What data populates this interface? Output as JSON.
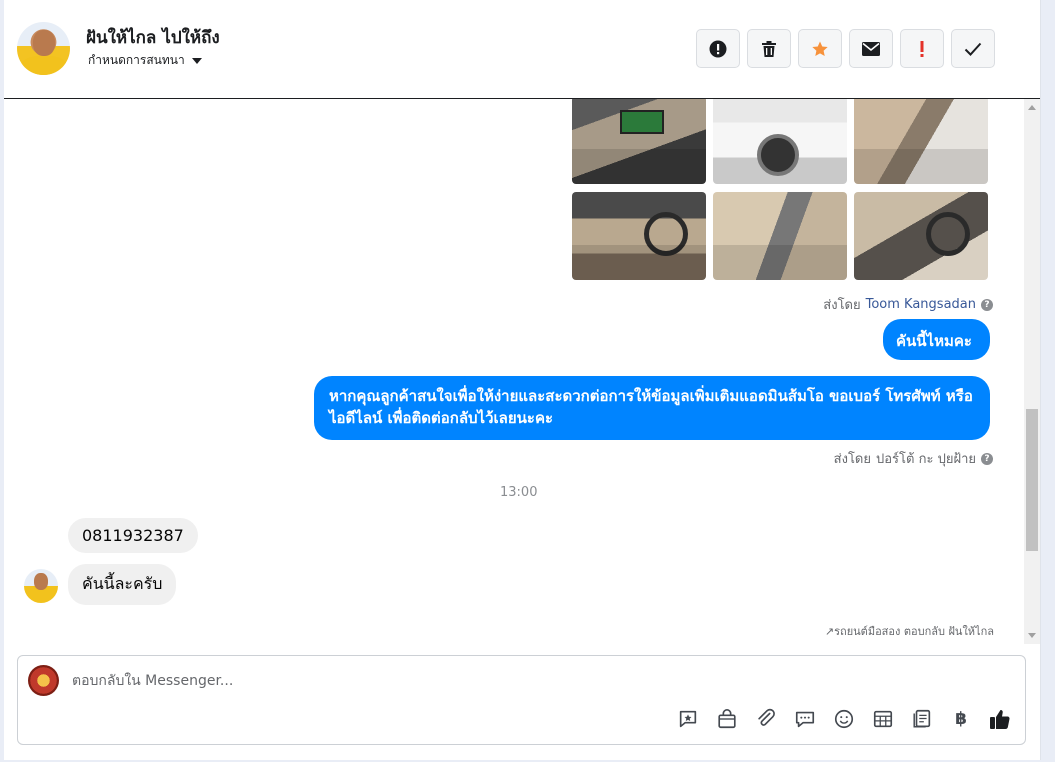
{
  "header": {
    "contact_name": "ฝันให้ไกล ไปให้ถึง",
    "assign_label": "กำหนดการสนทนา",
    "actions": [
      {
        "name": "report-spam",
        "icon": "exclamation-circle-icon"
      },
      {
        "name": "delete",
        "icon": "trash-icon"
      },
      {
        "name": "star",
        "icon": "star-icon",
        "color": "#f7923b"
      },
      {
        "name": "mark-unread",
        "icon": "envelope-icon"
      },
      {
        "name": "follow-up",
        "icon": "exclamation-icon",
        "color": "#e4322a"
      },
      {
        "name": "mark-done",
        "icon": "check-icon"
      }
    ]
  },
  "conversation": {
    "sent_by_1": {
      "prefix": "ส่งโดย",
      "name": "Toom Kangsadan"
    },
    "msg_out_1": "คันนี้ไหมคะ",
    "msg_out_2": "หากคุณลูกค้าสนใจเพื่อให้ง่ายและสะดวกต่อการให้ข้อมูลเพิ่มเติมแอดมินส้มโอ ขอเบอร์ โทรศัพท์ หรือ ไอดีไลน์ เพื่อติดต่อกลับไว้เลยนะคะ",
    "sent_by_2": {
      "prefix": "ส่งโดย",
      "name": "ปอร์โต้ กะ ปุยฝ้าย"
    },
    "time_divider": "13:00",
    "msg_in_1": "0811932387",
    "msg_in_2": "คันนี้ละครับ",
    "footnote": "รถยนต์มือสอง ตอบกลับ ฝันให้ไกล"
  },
  "composer": {
    "placeholder": "ตอบกลับใน Messenger...",
    "tools": [
      "saved-reply-icon",
      "shop-bag-icon",
      "attach-icon",
      "chat-bubble-icon",
      "emoji-icon",
      "table-icon",
      "document-icon",
      "baht-icon",
      "thumbs-up-icon"
    ],
    "baht_symbol": "฿"
  },
  "colors": {
    "accent": "#0084ff",
    "link": "#385898"
  }
}
